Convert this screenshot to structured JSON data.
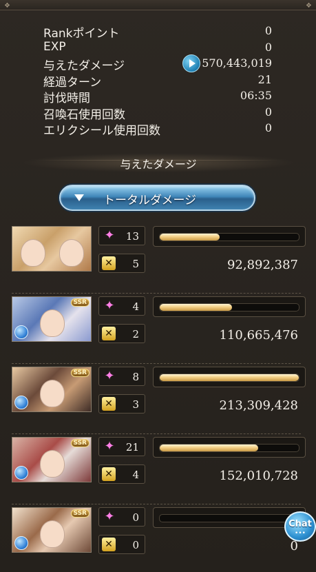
{
  "stats": [
    {
      "label": "Rankポイント",
      "value": "0"
    },
    {
      "label": "EXP",
      "value": "0"
    },
    {
      "label": "与えたダメージ",
      "value": "570,443,019"
    },
    {
      "label": "経過ターン",
      "value": "21"
    },
    {
      "label": "討伐時間",
      "value": "06:35"
    },
    {
      "label": "召喚石使用回数",
      "value": "0"
    },
    {
      "label": "エリクシール使用回数",
      "value": "0"
    }
  ],
  "section_title": "与えたダメージ",
  "total_button_label": "トータルダメージ",
  "entries": [
    {
      "ougi_count": "13",
      "chain_count": "5",
      "damage": "92,892,387",
      "bar_fraction": 0.43,
      "badge": "",
      "has_element": false
    },
    {
      "ougi_count": "4",
      "chain_count": "2",
      "damage": "110,665,476",
      "bar_fraction": 0.52,
      "badge": "SSR",
      "has_element": true
    },
    {
      "ougi_count": "8",
      "chain_count": "3",
      "damage": "213,309,428",
      "bar_fraction": 1.0,
      "badge": "SSR",
      "has_element": true
    },
    {
      "ougi_count": "21",
      "chain_count": "4",
      "damage": "152,010,728",
      "bar_fraction": 0.71,
      "badge": "SSR",
      "has_element": true
    },
    {
      "ougi_count": "0",
      "chain_count": "0",
      "damage": "0",
      "bar_fraction": 0.0,
      "badge": "SSR",
      "has_element": true
    }
  ],
  "chat_label": "Chat",
  "colors": {
    "accent_blue": "#3f86b9",
    "bar_gold": "#f3cf85",
    "ougi_pink": "#ff7fe6"
  },
  "icons": {
    "ougi": "ougi-star-icon",
    "chain": "chain-burst-icon",
    "play": "play-icon"
  }
}
